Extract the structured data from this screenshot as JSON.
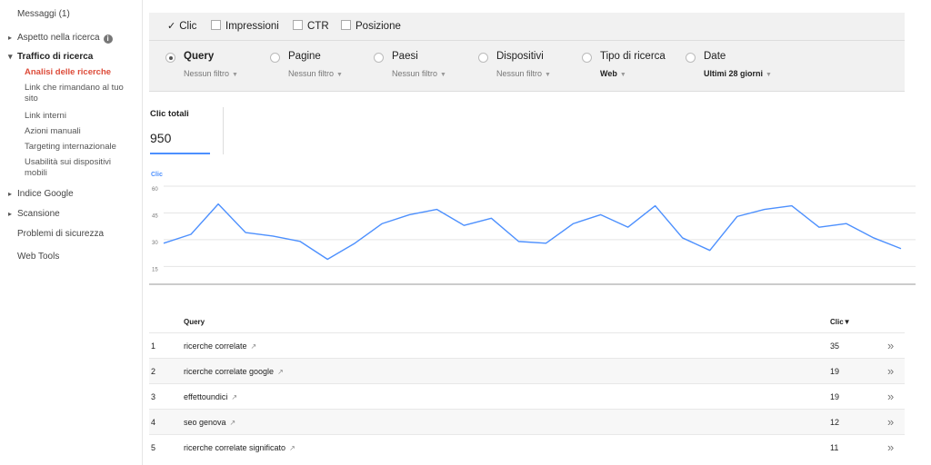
{
  "sidebar": {
    "messages": "Messaggi (1)",
    "appearance": "Aspetto nella ricerca",
    "traffic": "Traffico di ricerca",
    "sub_items": [
      "Analisi delle ricerche",
      "Link che rimandano al tuo sito",
      "Link interni",
      "Azioni manuali",
      "Targeting internazionale",
      "Usabilità sui dispositivi mobili"
    ],
    "google_index": "Indice Google",
    "crawl": "Scansione",
    "security": "Problemi di sicurezza",
    "web_tools": "Web Tools"
  },
  "metrics": {
    "clicks": "Clic",
    "impressions": "Impressioni",
    "ctr": "CTR",
    "position": "Posizione"
  },
  "groups": [
    {
      "label": "Query",
      "filter": "Nessun filtro",
      "selected": true
    },
    {
      "label": "Pagine",
      "filter": "Nessun filtro",
      "selected": false
    },
    {
      "label": "Paesi",
      "filter": "Nessun filtro",
      "selected": false
    },
    {
      "label": "Dispositivi",
      "filter": "Nessun filtro",
      "selected": false
    },
    {
      "label": "Tipo di ricerca",
      "filter": "Web",
      "selected": false
    },
    {
      "label": "Date",
      "filter": "Ultimi 28 giorni",
      "selected": false
    }
  ],
  "totals": {
    "title": "Clic totali",
    "value": "950"
  },
  "chart_data": {
    "type": "line",
    "title": "",
    "ylabel": "Clic",
    "ylim": [
      5,
      60
    ],
    "yticks": [
      15,
      30,
      45,
      60
    ],
    "line_color": "#4d90fe",
    "grid": true,
    "series": [
      {
        "values": [
          28,
          33,
          50,
          34,
          32,
          29,
          19,
          28,
          39,
          44,
          47,
          38,
          42,
          29,
          28,
          39,
          44,
          37,
          49,
          31,
          24,
          43,
          47,
          49,
          37,
          39,
          31,
          25
        ]
      }
    ]
  },
  "table": {
    "col_query": "Query",
    "col_clicks": "Clic▼",
    "rows": [
      {
        "rank": "1",
        "query": "ricerche correlate",
        "clicks": "35"
      },
      {
        "rank": "2",
        "query": "ricerche correlate google",
        "clicks": "19"
      },
      {
        "rank": "3",
        "query": "effettoundici",
        "clicks": "19"
      },
      {
        "rank": "4",
        "query": "seo genova",
        "clicks": "12"
      },
      {
        "rank": "5",
        "query": "ricerche correlate significato",
        "clicks": "11"
      }
    ]
  },
  "glyphs": {
    "check": "✓",
    "dropdown": "▼",
    "external": "↗",
    "chevron": "»",
    "info": "i"
  }
}
